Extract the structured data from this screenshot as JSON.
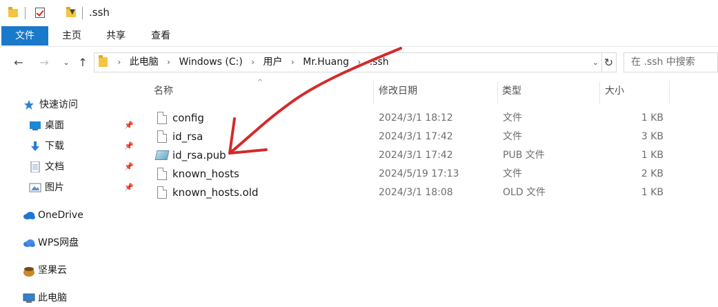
{
  "window": {
    "title": ".ssh"
  },
  "ribbon": {
    "tabs": [
      "文件",
      "主页",
      "共享",
      "查看"
    ]
  },
  "address": {
    "crumbs": [
      "此电脑",
      "Windows (C:)",
      "用户",
      "Mr.Huang",
      ".ssh"
    ],
    "search_placeholder": "在 .ssh 中搜索"
  },
  "sidebar": {
    "items": [
      {
        "label": "快速访问",
        "icon": "star-icon",
        "pinned": false
      },
      {
        "label": "桌面",
        "icon": "desktop-icon",
        "pinned": true
      },
      {
        "label": "下载",
        "icon": "download-icon",
        "pinned": true
      },
      {
        "label": "文档",
        "icon": "document-icon",
        "pinned": true
      },
      {
        "label": "图片",
        "icon": "picture-icon",
        "pinned": true
      },
      {
        "label": "OneDrive",
        "icon": "cloud-icon",
        "pinned": false
      },
      {
        "label": "WPS网盘",
        "icon": "wps-cloud-icon",
        "pinned": false
      },
      {
        "label": "坚果云",
        "icon": "nut-icon",
        "pinned": false
      },
      {
        "label": "此电脑",
        "icon": "computer-icon",
        "pinned": false
      }
    ]
  },
  "columns": [
    "名称",
    "修改日期",
    "类型",
    "大小"
  ],
  "files": [
    {
      "name": "config",
      "date": "2024/3/1 18:12",
      "type": "文件",
      "size": "1 KB",
      "icon": "file-icon"
    },
    {
      "name": "id_rsa",
      "date": "2024/3/1 17:42",
      "type": "文件",
      "size": "3 KB",
      "icon": "file-icon"
    },
    {
      "name": "id_rsa.pub",
      "date": "2024/3/1 17:42",
      "type": "PUB 文件",
      "size": "1 KB",
      "icon": "pub-file-icon"
    },
    {
      "name": "known_hosts",
      "date": "2024/5/19 17:13",
      "type": "文件",
      "size": "2 KB",
      "icon": "file-icon"
    },
    {
      "name": "known_hosts.old",
      "date": "2024/3/1 18:08",
      "type": "OLD 文件",
      "size": "1 KB",
      "icon": "file-icon"
    }
  ],
  "annotation": {
    "color": "#d42a2a"
  }
}
